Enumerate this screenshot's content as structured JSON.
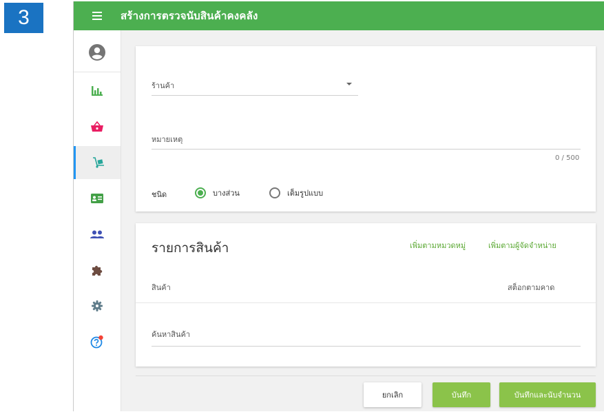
{
  "step_number": "3",
  "header": {
    "title": "สร้างการตรวจนับสินค้าคงคลัง",
    "menu_icon": "hamburger-menu-icon",
    "bar_color": "#4caf50"
  },
  "sidebar": {
    "items": [
      {
        "icon": "account-circle-icon",
        "color": "#757575"
      },
      {
        "icon": "bar-chart-icon",
        "color": "#4caf50"
      },
      {
        "icon": "shopping-basket-icon",
        "color": "#e91e63"
      },
      {
        "icon": "hand-truck-icon",
        "color": "#26a69a",
        "active": true
      },
      {
        "icon": "id-card-icon",
        "color": "#43a047"
      },
      {
        "icon": "people-icon",
        "color": "#3f51b5"
      },
      {
        "icon": "puzzle-icon",
        "color": "#6d4c41"
      },
      {
        "icon": "gear-icon",
        "color": "#607d8b"
      },
      {
        "icon": "help-icon",
        "color": "#1e88e5"
      }
    ]
  },
  "form": {
    "store": {
      "label": "ร้านค้า",
      "value": ""
    },
    "note": {
      "label": "หมายเหตุ",
      "value": "",
      "counter": "0 / 500"
    },
    "type": {
      "label": "ชนิด",
      "options": [
        {
          "label": "บางส่วน",
          "checked": true
        },
        {
          "label": "เต็มรูปแบบ",
          "checked": false
        }
      ]
    }
  },
  "products": {
    "title": "รายการสินค้า",
    "add_by_category": "เพิ่มตามหมวดหมู่",
    "add_by_supplier": "เพิ่มตามผู้จัดจำหน่าย",
    "columns": [
      "สินค้า",
      "สต็อกตามคาด"
    ],
    "search_placeholder": "ค้นหาสินค้า"
  },
  "footer": {
    "cancel": "ยกเลิก",
    "save": "บันทึก",
    "save_and_count": "บันทึกและนับจำนวน"
  },
  "colors": {
    "accent_green": "#8bc34a",
    "link_green": "#5aa832",
    "active_indicator": "#2196f3",
    "step_badge": "#1a73c2"
  }
}
